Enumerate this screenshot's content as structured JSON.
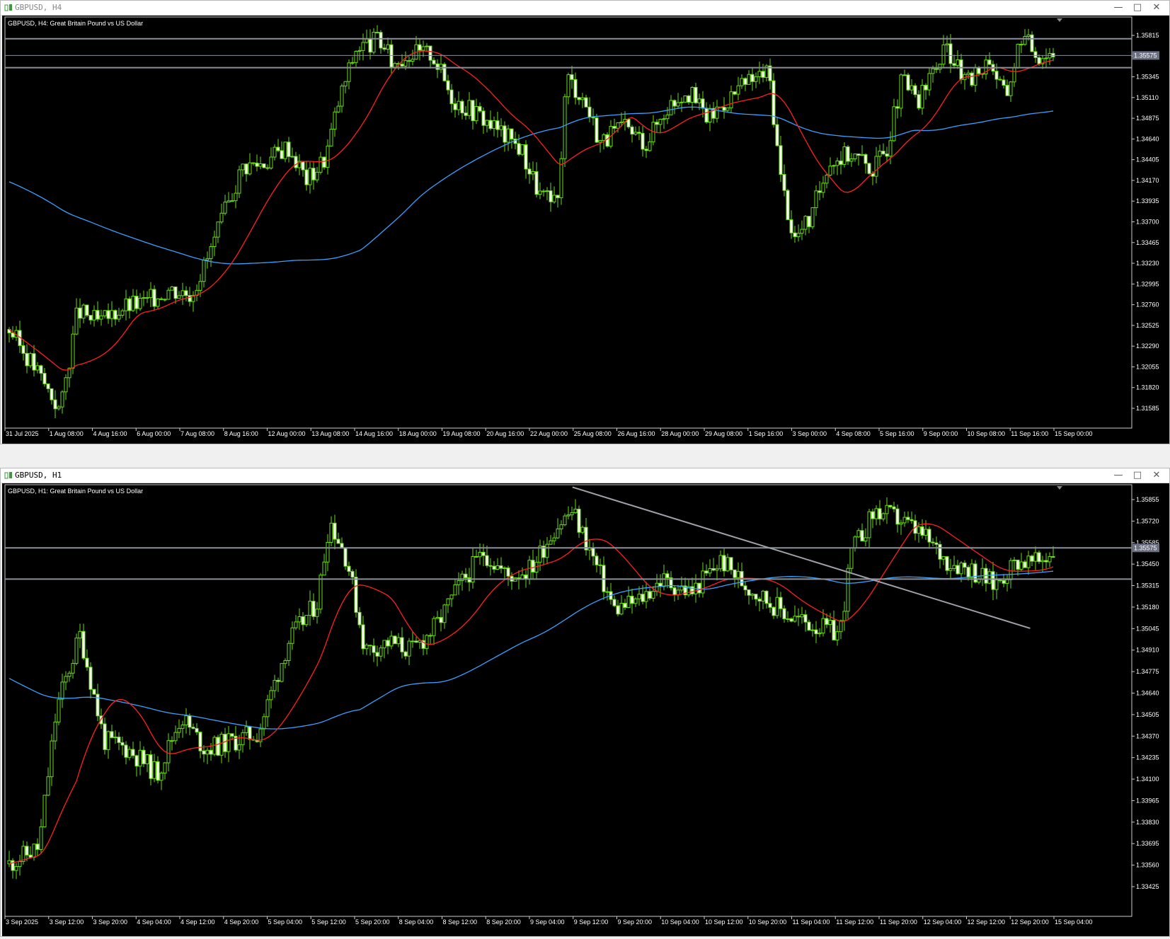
{
  "windows": [
    {
      "id": "h4",
      "window_title": "GBPUSD, H4",
      "title_color": "#888888",
      "active": false,
      "chart_label": "GBPUSD, H4:  Great Britain Pound vs US Dollar",
      "current_price": "1.35575",
      "price_axis": [
        "1.35815",
        "1.35580",
        "1.35345",
        "1.35110",
        "1.34875",
        "1.34640",
        "1.34405",
        "1.34170",
        "1.33935",
        "1.33700",
        "1.33465",
        "1.33230",
        "1.32995",
        "1.32760",
        "1.32525",
        "1.32290",
        "1.32055",
        "1.31820",
        "1.31585"
      ],
      "time_axis": [
        "31 Jul 2025",
        "1 Aug 08:00",
        "4 Aug 16:00",
        "6 Aug 00:00",
        "7 Aug 08:00",
        "8 Aug 16:00",
        "12 Aug 00:00",
        "13 Aug 08:00",
        "14 Aug 16:00",
        "18 Aug 00:00",
        "19 Aug 08:00",
        "20 Aug 16:00",
        "22 Aug 00:00",
        "25 Aug 08:00",
        "26 Aug 16:00",
        "28 Aug 00:00",
        "29 Aug 08:00",
        "1 Sep 16:00",
        "3 Sep 00:00",
        "4 Sep 08:00",
        "5 Sep 16:00",
        "9 Sep 00:00",
        "10 Sep 08:00",
        "11 Sep 16:00",
        "15 Sep 00:00"
      ],
      "chart_data": {
        "type": "candlestick",
        "symbol": "GBPUSD",
        "timeframe": "H4",
        "ylim": [
          1.3146,
          1.36
        ],
        "x_range_hours": [
          0,
          816
        ],
        "horizontal_lines": [
          1.3576,
          1.35575,
          1.3544
        ],
        "close_path": [
          [
            0,
            1.3255
          ],
          [
            24,
            1.321
          ],
          [
            45,
            1.3165
          ],
          [
            60,
            1.3275
          ],
          [
            80,
            1.3262
          ],
          [
            100,
            1.328
          ],
          [
            120,
            1.3285
          ],
          [
            140,
            1.33
          ],
          [
            160,
            1.3295
          ],
          [
            175,
            1.3335
          ],
          [
            190,
            1.3385
          ],
          [
            205,
            1.3435
          ],
          [
            225,
            1.344
          ],
          [
            245,
            1.3458
          ],
          [
            262,
            1.342
          ],
          [
            278,
            1.3445
          ],
          [
            290,
            1.3508
          ],
          [
            305,
            1.3565
          ],
          [
            325,
            1.3575
          ],
          [
            338,
            1.3548
          ],
          [
            350,
            1.356
          ],
          [
            372,
            1.356
          ],
          [
            390,
            1.351
          ],
          [
            410,
            1.3495
          ],
          [
            430,
            1.3475
          ],
          [
            450,
            1.3455
          ],
          [
            466,
            1.3405
          ],
          [
            482,
            1.339
          ],
          [
            490,
            1.3535
          ],
          [
            505,
            1.351
          ],
          [
            520,
            1.3462
          ],
          [
            540,
            1.3478
          ],
          [
            560,
            1.3462
          ],
          [
            578,
            1.35
          ],
          [
            595,
            1.352
          ],
          [
            615,
            1.3488
          ],
          [
            632,
            1.351
          ],
          [
            652,
            1.353
          ],
          [
            668,
            1.354
          ],
          [
            678,
            1.3425
          ],
          [
            690,
            1.3355
          ],
          [
            705,
            1.3378
          ],
          [
            720,
            1.344
          ],
          [
            740,
            1.345
          ],
          [
            760,
            1.3432
          ],
          [
            772,
            1.3458
          ],
          [
            785,
            1.353
          ],
          [
            800,
            1.3505
          ],
          [
            812,
            1.354
          ],
          [
            825,
            1.3566
          ],
          [
            842,
            1.3525
          ],
          [
            862,
            1.3555
          ],
          [
            876,
            1.351
          ],
          [
            890,
            1.358
          ],
          [
            905,
            1.3558
          ],
          [
            918,
            1.3562
          ]
        ],
        "seed": 3,
        "ma_fast": {
          "color": "#ff2020",
          "period": 20
        },
        "ma_slow": {
          "color": "#3aa0ff",
          "period": 100,
          "start": 1.3418
        }
      }
    },
    {
      "id": "h1",
      "window_title": "GBPUSD, H1",
      "title_color": "#000000",
      "active": true,
      "chart_label": "GBPUSD, H1:  Great Britain Pound vs US Dollar",
      "current_price": "1.35575",
      "price_axis": [
        "1.35855",
        "1.35720",
        "1.35585",
        "1.35450",
        "1.35315",
        "1.35180",
        "1.35045",
        "1.34910",
        "1.34775",
        "1.34640",
        "1.34505",
        "1.34370",
        "1.34235",
        "1.34100",
        "1.33965",
        "1.33830",
        "1.33695",
        "1.33560",
        "1.33425"
      ],
      "time_axis": [
        "3 Sep 2025",
        "3 Sep 12:00",
        "3 Sep 20:00",
        "4 Sep 04:00",
        "4 Sep 12:00",
        "4 Sep 20:00",
        "5 Sep 04:00",
        "5 Sep 12:00",
        "5 Sep 20:00",
        "8 Sep 04:00",
        "8 Sep 12:00",
        "8 Sep 20:00",
        "9 Sep 04:00",
        "9 Sep 12:00",
        "9 Sep 20:00",
        "10 Sep 04:00",
        "10 Sep 12:00",
        "10 Sep 20:00",
        "11 Sep 04:00",
        "11 Sep 12:00",
        "11 Sep 20:00",
        "12 Sep 04:00",
        "12 Sep 12:00",
        "12 Sep 20:00",
        "15 Sep 04:00"
      ],
      "chart_data": {
        "type": "candlestick",
        "symbol": "GBPUSD",
        "timeframe": "H1",
        "ylim": [
          1.3333,
          1.3596
        ],
        "x_range_hours": [
          0,
          200
        ],
        "horizontal_lines": [
          1.35575,
          1.35385
        ],
        "trendline": {
          "from": [
            95,
            1.35945
          ],
          "to": [
            172,
            1.35085
          ],
          "color": "#a0a0a8"
        },
        "close_path": [
          [
            0,
            1.3365
          ],
          [
            5,
            1.3375
          ],
          [
            8,
            1.346
          ],
          [
            12,
            1.3505
          ],
          [
            16,
            1.344
          ],
          [
            20,
            1.3435
          ],
          [
            25,
            1.342
          ],
          [
            29,
            1.3455
          ],
          [
            33,
            1.3435
          ],
          [
            38,
            1.344
          ],
          [
            42,
            1.3445
          ],
          [
            47,
            1.35
          ],
          [
            52,
            1.3525
          ],
          [
            54,
            1.3575
          ],
          [
            57,
            1.355
          ],
          [
            60,
            1.3495
          ],
          [
            64,
            1.35
          ],
          [
            68,
            1.3495
          ],
          [
            72,
            1.351
          ],
          [
            76,
            1.3535
          ],
          [
            80,
            1.3555
          ],
          [
            84,
            1.354
          ],
          [
            88,
            1.3545
          ],
          [
            92,
            1.357
          ],
          [
            95,
            1.358
          ],
          [
            98,
            1.3555
          ],
          [
            102,
            1.352
          ],
          [
            106,
            1.3525
          ],
          [
            110,
            1.3538
          ],
          [
            115,
            1.353
          ],
          [
            120,
            1.355
          ],
          [
            124,
            1.3535
          ],
          [
            128,
            1.3525
          ],
          [
            132,
            1.3515
          ],
          [
            136,
            1.351
          ],
          [
            140,
            1.3505
          ],
          [
            142,
            1.3555
          ],
          [
            146,
            1.358
          ],
          [
            150,
            1.3575
          ],
          [
            154,
            1.3565
          ],
          [
            158,
            1.355
          ],
          [
            162,
            1.3545
          ],
          [
            166,
            1.3535
          ],
          [
            170,
            1.355
          ],
          [
            173,
            1.3548
          ],
          [
            176,
            1.3555
          ]
        ],
        "seed": 11,
        "ma_fast": {
          "color": "#ff2020",
          "period": 20
        },
        "ma_slow": {
          "color": "#3aa0ff",
          "period": 100,
          "start": 1.3478
        }
      }
    }
  ]
}
